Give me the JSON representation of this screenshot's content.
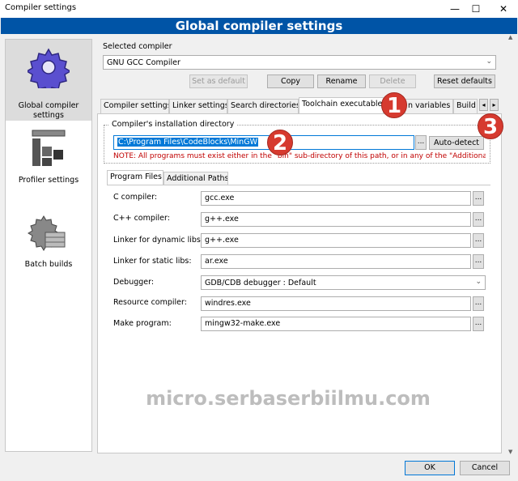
{
  "window": {
    "title": "Compiler settings",
    "minimize": "—",
    "maximize": "☐",
    "close": "✕"
  },
  "banner": {
    "text": "Global compiler settings"
  },
  "sidebar": {
    "items": [
      {
        "label": "Global compiler settings",
        "icon": "gear-icon"
      },
      {
        "label": "Profiler settings",
        "icon": "caliper-icon"
      },
      {
        "label": "Batch builds",
        "icon": "batch-icon"
      }
    ]
  },
  "selected_compiler": {
    "label": "Selected compiler",
    "value": "GNU GCC Compiler"
  },
  "compiler_buttons": {
    "set_default": "Set as default",
    "copy": "Copy",
    "rename": "Rename",
    "delete": "Delete",
    "reset": "Reset defaults"
  },
  "tabs": [
    "Compiler settings",
    "Linker settings",
    "Search directories",
    "Toolchain executables",
    "Custom variables",
    "Build"
  ],
  "tab_partial": "n variables",
  "tab_scroll": {
    "left": "◂",
    "right": "▸"
  },
  "install_dir": {
    "label": "Compiler's installation directory",
    "value": "C:\\Program Files\\CodeBlocks\\MinGW",
    "browse": "...",
    "autodetect": "Auto-detect",
    "note": "NOTE: All programs must exist either in the \"bin\" sub-directory of this path, or in any of the \"Additional"
  },
  "subtabs": [
    "Program Files",
    "Additional Paths"
  ],
  "programs": {
    "c_compiler": {
      "label": "C compiler:",
      "value": "gcc.exe"
    },
    "cpp_compiler": {
      "label": "C++ compiler:",
      "value": "g++.exe"
    },
    "linker_dynamic": {
      "label": "Linker for dynamic libs:",
      "value": "g++.exe"
    },
    "linker_static": {
      "label": "Linker for static libs:",
      "value": "ar.exe"
    },
    "debugger": {
      "label": "Debugger:",
      "value": "GDB/CDB debugger : Default"
    },
    "resource_compiler": {
      "label": "Resource compiler:",
      "value": "windres.exe"
    },
    "make_program": {
      "label": "Make program:",
      "value": "mingw32-make.exe"
    },
    "browse": "..."
  },
  "badges": [
    "1",
    "2",
    "3"
  ],
  "badge_color": "#d63a2f",
  "watermark": "micro.serbaserbiilmu.com",
  "footer": {
    "ok": "OK",
    "cancel": "Cancel"
  },
  "colors": {
    "banner": "#0054a6",
    "note": "#c00000",
    "selection": "#0078d7"
  }
}
